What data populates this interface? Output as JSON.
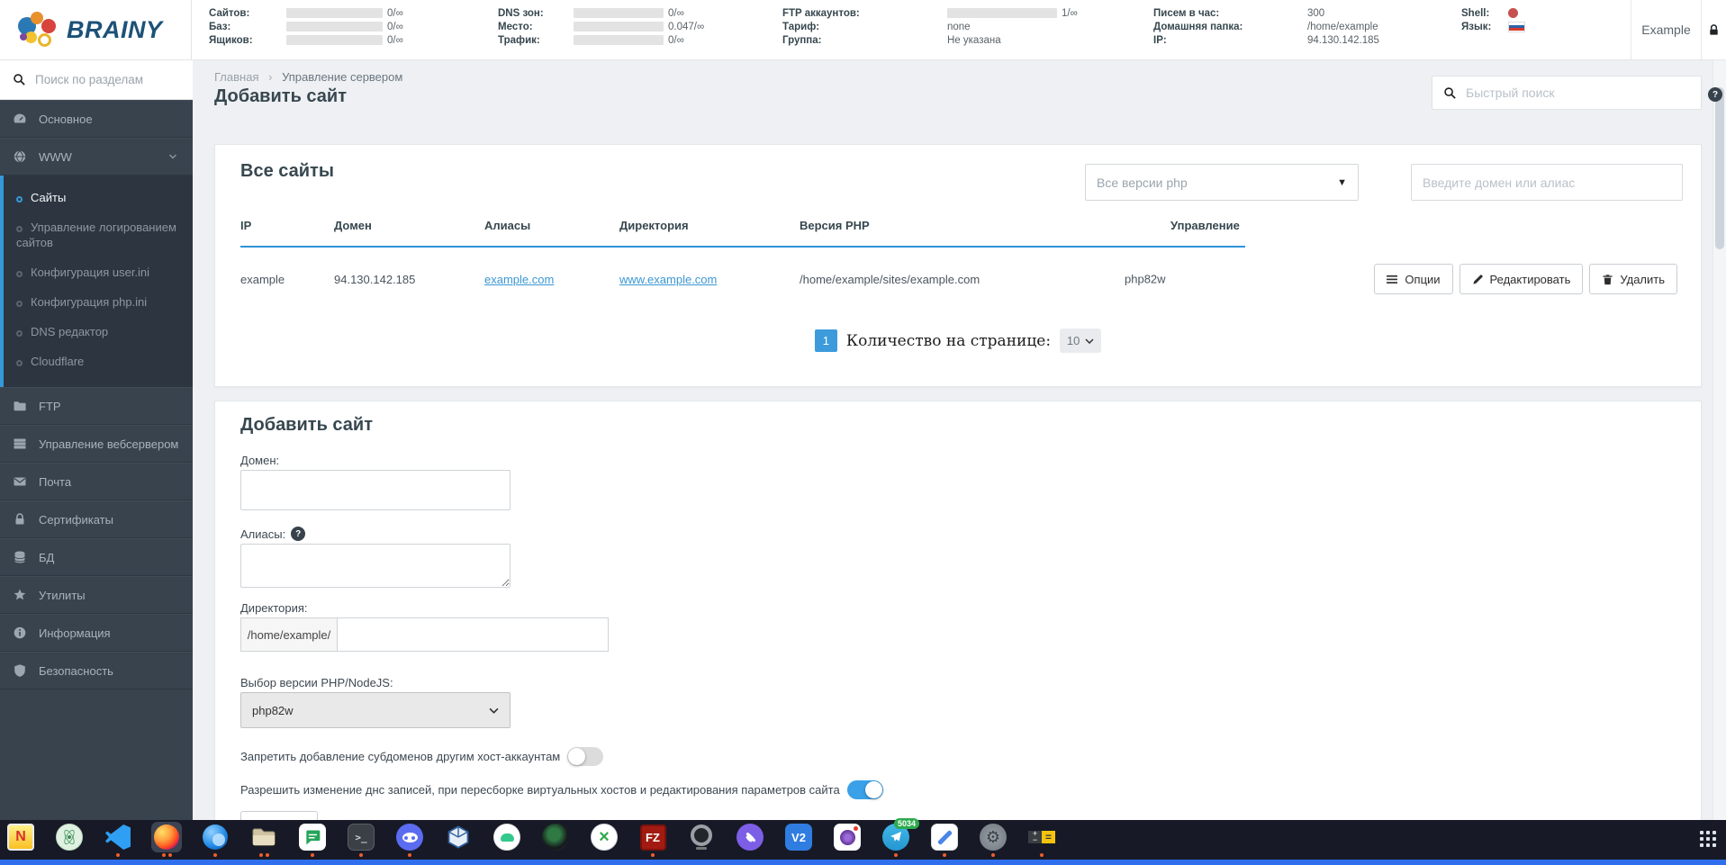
{
  "header": {
    "logo": "BRAINY",
    "stats": {
      "col1": [
        {
          "label": "Сайтов:",
          "value": "0/∞"
        },
        {
          "label": "Баз:",
          "value": "0/∞"
        },
        {
          "label": "Ящиков:",
          "value": "0/∞"
        }
      ],
      "col2": [
        {
          "label": "DNS зон:",
          "value": "0/∞"
        },
        {
          "label": "Место:",
          "value": "0.047/∞"
        },
        {
          "label": "Трафик:",
          "value": "0/∞"
        }
      ],
      "col3": [
        {
          "label": "FTP аккаунтов:",
          "value": "1/∞"
        },
        {
          "label": "Тариф:",
          "value": "none"
        },
        {
          "label": "Группа:",
          "value": "Не указана"
        }
      ],
      "col4": [
        {
          "label": "Писем в час:",
          "value": "300"
        },
        {
          "label": "Домашняя папка:",
          "value": "/home/example"
        },
        {
          "label": "IP:",
          "value": "94.130.142.185"
        }
      ],
      "shell_label": "Shell:",
      "language_label": "Язык:"
    },
    "username": "Example"
  },
  "sidebar": {
    "search_placeholder": "Поиск по разделам",
    "items": [
      {
        "label": "Основное",
        "icon": "dashboard-icon"
      },
      {
        "label": "WWW",
        "icon": "globe-icon"
      },
      {
        "label": "FTP",
        "icon": "folder-icon"
      },
      {
        "label": "Управление вебсервером",
        "icon": "server-icon"
      },
      {
        "label": "Почта",
        "icon": "mail-icon"
      },
      {
        "label": "Сертификаты",
        "icon": "lock-icon"
      },
      {
        "label": "БД",
        "icon": "database-icon"
      },
      {
        "label": "Утилиты",
        "icon": "star-icon"
      },
      {
        "label": "Информация",
        "icon": "info-icon"
      },
      {
        "label": "Безопасность",
        "icon": "shield-icon"
      }
    ],
    "www_submenu": [
      {
        "label": "Сайты",
        "active": true
      },
      {
        "label": "Управление логированием сайтов",
        "active": false
      },
      {
        "label": "Конфигурация user.ini",
        "active": false
      },
      {
        "label": "Конфигурация php.ini",
        "active": false
      },
      {
        "label": "DNS редактор",
        "active": false
      },
      {
        "label": "Cloudflare",
        "active": false
      }
    ]
  },
  "page": {
    "breadcrumb_home": "Главная",
    "breadcrumb_separator": "›",
    "breadcrumb_current": "Управление сервером",
    "title": "Добавить сайт",
    "quick_search_placeholder": "Быстрый поиск"
  },
  "sites": {
    "title": "Все сайты",
    "php_filter_value": "Все версии php",
    "domain_filter_placeholder": "Введите домен или алиас",
    "columns": [
      "IP",
      "Домен",
      "Алиасы",
      "Директория",
      "Версия PHP",
      "Управление"
    ],
    "row": {
      "ip": "example",
      "domain": "94.130.142.185",
      "alias": "example.com",
      "directory": "www.example.com",
      "path": "/home/example/sites/example.com",
      "php_version": "php82w"
    },
    "actions": {
      "options": "Опции",
      "edit": "Редактировать",
      "delete": "Удалить"
    },
    "pagination": {
      "page": "1",
      "per_page_label": "Количество на странице:",
      "per_page": "10"
    }
  },
  "form": {
    "title": "Добавить сайт",
    "domain_label": "Домен:",
    "aliases_label": "Алиасы:",
    "directory_label": "Директория:",
    "directory_prefix": "/home/example/",
    "php_label": "Выбор версии PHP/NodeJS:",
    "php_value": "php82w",
    "toggle_subdomains_label": "Запретить добавление субдоменов другим хост-аккаунтам",
    "toggle_dns_label": "Разрешить изменение днс записей, при пересборке виртуальных хостов и редактирования параметров сайта"
  },
  "taskbar": {
    "telegram_badge": "5034",
    "apps": [
      "notepad",
      "science",
      "vscode",
      "firefox",
      "thunderbird",
      "file-manager",
      "messages",
      "terminal",
      "discord",
      "virtualbox",
      "android",
      "camera-lens",
      "crossover",
      "filezilla",
      "webcam",
      "viber",
      "vnc-viewer",
      "camera",
      "telegram",
      "text-editor",
      "settings",
      "calculator"
    ]
  },
  "colors": {
    "accent_blue": "#3598db",
    "sidebar_bg": "#39434e",
    "taskbar_bg": "#171a26",
    "toggle_on": "#3aa0e8"
  }
}
